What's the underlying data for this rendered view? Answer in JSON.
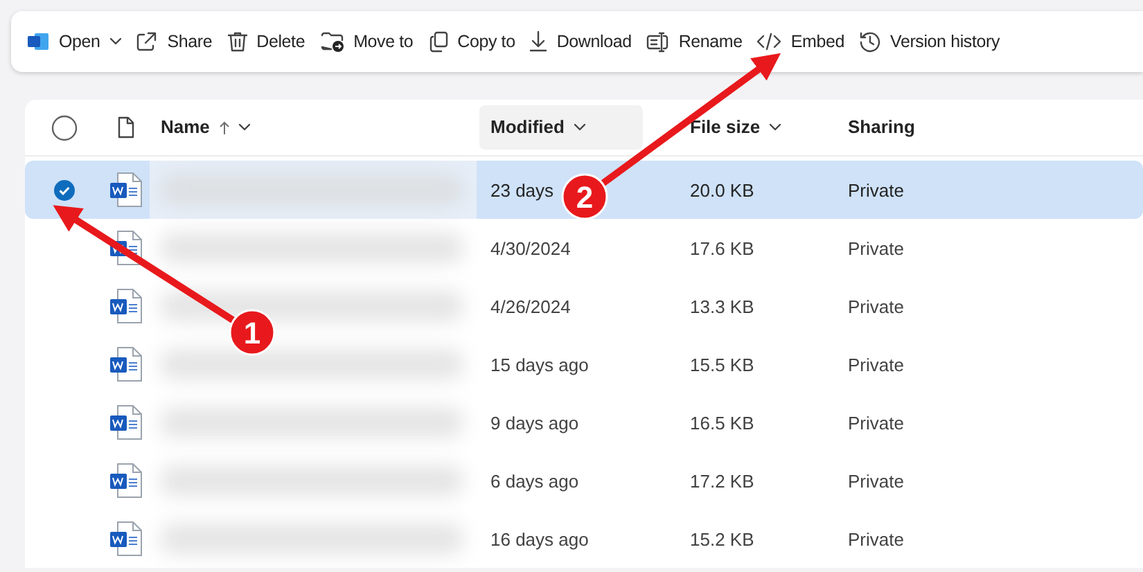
{
  "toolbar": [
    {
      "label": "Open",
      "dropdown": true
    },
    {
      "label": "Share",
      "dropdown": false
    },
    {
      "label": "Delete",
      "dropdown": false
    },
    {
      "label": "Move to",
      "dropdown": false
    },
    {
      "label": "Copy to",
      "dropdown": false
    },
    {
      "label": "Download",
      "dropdown": false
    },
    {
      "label": "Rename",
      "dropdown": false
    },
    {
      "label": "Embed",
      "dropdown": false
    },
    {
      "label": "Version history",
      "dropdown": false
    }
  ],
  "table": {
    "select_all": {
      "checked": false
    },
    "columns": [
      {
        "label": "Name",
        "sorted": true,
        "dropdown": true,
        "highlighted": false
      },
      {
        "label": "Modified",
        "sorted": false,
        "dropdown": true,
        "highlighted": true
      },
      {
        "label": "File size",
        "sorted": false,
        "dropdown": true,
        "highlighted": false
      },
      {
        "label": "Sharing",
        "sorted": false,
        "dropdown": false,
        "highlighted": false
      }
    ],
    "rows": [
      {
        "selected": true,
        "modified": "23 days",
        "size": "20.0 KB",
        "sharing": "Private"
      },
      {
        "selected": false,
        "modified": "4/30/2024",
        "size": "17.6 KB",
        "sharing": "Private"
      },
      {
        "selected": false,
        "modified": "4/26/2024",
        "size": "13.3 KB",
        "sharing": "Private"
      },
      {
        "selected": false,
        "modified": "15 days ago",
        "size": "15.5 KB",
        "sharing": "Private"
      },
      {
        "selected": false,
        "modified": "9 days ago",
        "size": "16.5 KB",
        "sharing": "Private"
      },
      {
        "selected": false,
        "modified": "6 days ago",
        "size": "17.2 KB",
        "sharing": "Private"
      },
      {
        "selected": false,
        "modified": "16 days ago",
        "size": "15.2 KB",
        "sharing": "Private"
      }
    ]
  },
  "annotations": [
    {
      "label": "1"
    },
    {
      "label": "2"
    }
  ]
}
